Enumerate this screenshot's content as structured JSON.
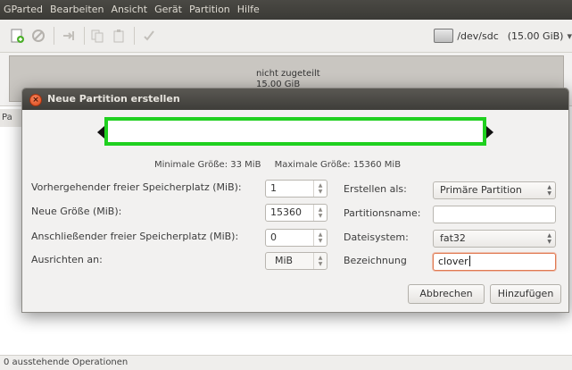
{
  "menubar": {
    "items": [
      "GParted",
      "Bearbeiten",
      "Ansicht",
      "Gerät",
      "Partition",
      "Hilfe"
    ]
  },
  "device": {
    "name": "/dev/sdc",
    "size": "(15.00 GiB)"
  },
  "graphic": {
    "label": "nicht zugeteilt",
    "size": "15.00 GiB"
  },
  "list_header_stub": "Pa",
  "status": "0 ausstehende Operationen",
  "dialog": {
    "title": "Neue Partition erstellen",
    "min_size": "Minimale Größe: 33 MiB",
    "max_size": "Maximale Größe: 15360 MiB",
    "fields": {
      "prev_free_label": "Vorhergehender freier Speicherplatz (MiB):",
      "prev_free_value": "1",
      "new_size_label": "Neue Größe (MiB):",
      "new_size_value": "15360",
      "following_free_label": "Anschließender freier Speicherplatz (MiB):",
      "following_free_value": "0",
      "align_label": "Ausrichten an:",
      "align_value": "MiB",
      "create_as_label": "Erstellen als:",
      "create_as_value": "Primäre Partition",
      "partition_name_label": "Partitionsname:",
      "partition_name_value": "",
      "filesystem_label": "Dateisystem:",
      "filesystem_value": "fat32",
      "label_label": "Bezeichnung",
      "label_value": "clover"
    },
    "buttons": {
      "cancel": "Abbrechen",
      "add": "Hinzufügen"
    }
  }
}
